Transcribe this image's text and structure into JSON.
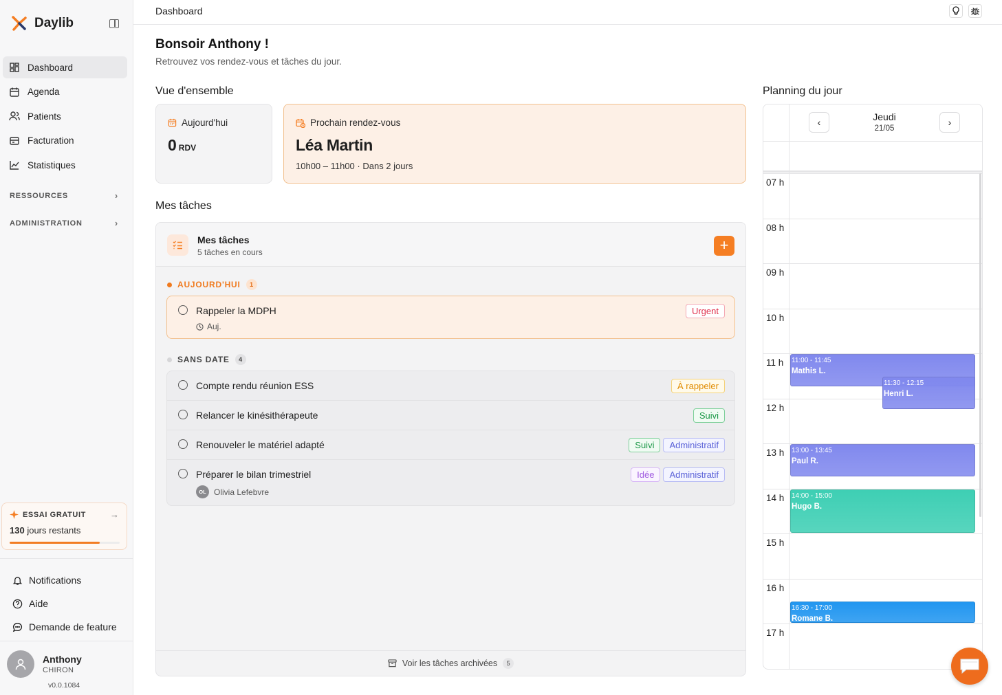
{
  "app": {
    "name": "Daylib",
    "version": "v0.0.1084"
  },
  "sidebar": {
    "items": [
      {
        "label": "Dashboard"
      },
      {
        "label": "Agenda"
      },
      {
        "label": "Patients"
      },
      {
        "label": "Facturation"
      },
      {
        "label": "Statistiques"
      }
    ],
    "sections": [
      "RESSOURCES",
      "ADMINISTRATION"
    ],
    "trial": {
      "title": "ESSAI GRATUIT",
      "days": "130",
      "days_suffix": "jours restants",
      "progress": 0.82
    },
    "links": [
      "Notifications",
      "Aide",
      "Demande de feature"
    ],
    "user": {
      "first_name": "Anthony",
      "last_name": "CHIRON"
    }
  },
  "topbar": {
    "breadcrumb": "Dashboard"
  },
  "header": {
    "greeting": "Bonsoir Anthony !",
    "subtitle": "Retrouvez vos rendez-vous et tâches du jour."
  },
  "overview": {
    "title": "Vue d'ensemble",
    "today": {
      "label": "Aujourd'hui",
      "count": "0",
      "unit": "RDV"
    },
    "next": {
      "label": "Prochain rendez-vous",
      "name": "Léa Martin",
      "when": "10h00 – 11h00 · Dans 2 jours"
    }
  },
  "tasks": {
    "section_title": "Mes tâches",
    "card_title": "Mes tâches",
    "card_subtitle": "5 tâches en cours",
    "add_label": "+",
    "groups": {
      "today": {
        "label": "AUJOURD'HUI",
        "count": "1"
      },
      "nodate": {
        "label": "SANS DATE",
        "count": "4"
      }
    },
    "today_items": [
      {
        "title": "Rappeler la MDPH",
        "meta": "Auj.",
        "tags": [
          "Urgent"
        ]
      }
    ],
    "nodate_items": [
      {
        "title": "Compte rendu réunion ESS",
        "tags": [
          "À rappeler"
        ]
      },
      {
        "title": "Relancer le kinésithérapeute",
        "tags": [
          "Suivi"
        ]
      },
      {
        "title": "Renouveler le matériel adapté",
        "tags": [
          "Suivi",
          "Administratif"
        ]
      },
      {
        "title": "Préparer le bilan trimestriel",
        "tags": [
          "Idée",
          "Administratif"
        ],
        "assignee_initials": "OL",
        "assignee": "Olivia Lefebvre"
      }
    ],
    "archived_label": "Voir les tâches archivées",
    "archived_count": "5"
  },
  "planning": {
    "title": "Planning du jour",
    "day": "Jeudi",
    "date": "21/05",
    "hours": [
      "07 h",
      "08 h",
      "09 h",
      "10 h",
      "11 h",
      "12 h",
      "13 h",
      "14 h",
      "15 h",
      "16 h",
      "17 h"
    ],
    "events": [
      {
        "time": "11:00 - 11:45",
        "name": "Mathis L.",
        "color": "#8189ee"
      },
      {
        "time": "11:30 - 12:15",
        "name": "Henri L.",
        "color": "#8189ee"
      },
      {
        "time": "13:00 - 13:45",
        "name": "Paul R.",
        "color": "#8189ee"
      },
      {
        "time": "14:00 - 15:00",
        "name": "Hugo B.",
        "color": "#3ecfb4"
      },
      {
        "time": "16:30 - 17:00",
        "name": "Romane B.",
        "color": "#2196f0"
      }
    ]
  },
  "colors": {
    "accent": "#f57e23",
    "sidebar_bg": "#f7f7f8"
  }
}
